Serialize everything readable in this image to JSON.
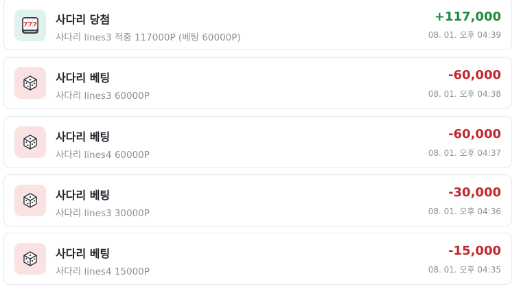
{
  "transactions": [
    {
      "type": "win",
      "icon": "slot-machine-icon",
      "title": "사다리 당첨",
      "description": "사다리 lines3 적중 117000P (베팅 60000P)",
      "amount": "+117,000",
      "amount_color": "#1a8a3c",
      "time": "08. 01. 오후 04:39"
    },
    {
      "type": "bet",
      "icon": "dice-icon",
      "title": "사다리 베팅",
      "description": "사다리 lines3 60000P",
      "amount": "-60,000",
      "amount_color": "#c0262d",
      "time": "08. 01. 오후 04:38"
    },
    {
      "type": "bet",
      "icon": "dice-icon",
      "title": "사다리 베팅",
      "description": "사다리 lines4 60000P",
      "amount": "-60,000",
      "amount_color": "#c0262d",
      "time": "08. 01. 오후 04:37"
    },
    {
      "type": "bet",
      "icon": "dice-icon",
      "title": "사다리 베팅",
      "description": "사다리 lines3 30000P",
      "amount": "-30,000",
      "amount_color": "#c0262d",
      "time": "08. 01. 오후 04:36"
    },
    {
      "type": "bet",
      "icon": "dice-icon",
      "title": "사다리 베팅",
      "description": "사다리 lines4 15000P",
      "amount": "-15,000",
      "amount_color": "#c0262d",
      "time": "08. 01. 오후 04:35"
    }
  ]
}
